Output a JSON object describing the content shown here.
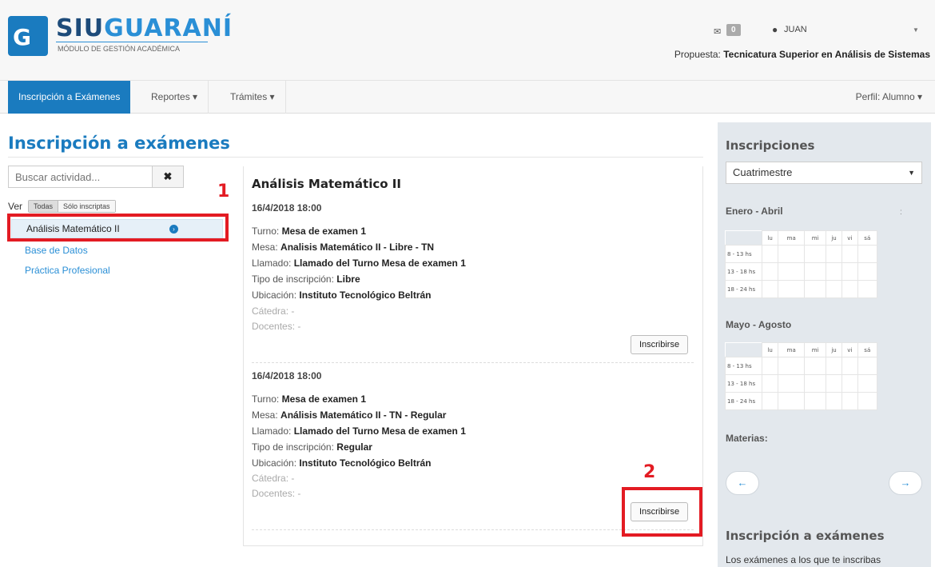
{
  "header": {
    "logo_letter": "G",
    "logo_siu": "SIU",
    "logo_guarani": "GUARANÍ",
    "logo_subtitle": "MÓDULO DE GESTIÓN ACADÉMICA",
    "mail_count": "0",
    "user_name": "JUAN",
    "propuesta_label": "Propuesta:",
    "propuesta_value": "Tecnicatura Superior en Análisis de Sistemas"
  },
  "navbar": {
    "items": [
      {
        "label": "Inscripción a Exámenes"
      },
      {
        "label": "Reportes ▾"
      },
      {
        "label": "Trámites ▾"
      }
    ],
    "perfil": "Perfil: Alumno ▾"
  },
  "page": {
    "title": "Inscripción a exámenes"
  },
  "sidebar": {
    "search_placeholder": "Buscar actividad...",
    "clear_icon": "✖",
    "ver_label": "Ver",
    "filters": [
      "Todas",
      "Sólo inscriptas"
    ],
    "activities": [
      "Análisis Matemático II",
      "Base de Datos",
      "Práctica Profesional"
    ],
    "chevron": "›"
  },
  "markers": {
    "one": "1",
    "two": "2"
  },
  "main": {
    "title": "Análisis Matemático II",
    "exams": [
      {
        "date": "16/4/2018 18:00",
        "turno_label": "Turno:",
        "turno": "Mesa de examen 1",
        "mesa_label": "Mesa:",
        "mesa": "Analisis Matemático II - Libre - TN",
        "llamado_label": "Llamado:",
        "llamado": "Llamado del Turno Mesa de examen 1",
        "tipo_label": "Tipo de inscripción:",
        "tipo": "Libre",
        "ubicacion_label": "Ubicación:",
        "ubicacion": "Instituto Tecnológico Beltrán",
        "catedra": "Cátedra: -",
        "docentes": "Docentes: -",
        "button": "Inscribirse"
      },
      {
        "date": "16/4/2018 18:00",
        "turno_label": "Turno:",
        "turno": "Mesa de examen 1",
        "mesa_label": "Mesa:",
        "mesa": "Análisis Matemático II - TN - Regular",
        "llamado_label": "Llamado:",
        "llamado": "Llamado del Turno Mesa de examen 1",
        "tipo_label": "Tipo de inscripción:",
        "tipo": "Regular",
        "ubicacion_label": "Ubicación:",
        "ubicacion": "Instituto Tecnológico Beltrán",
        "catedra": "Cátedra: -",
        "docentes": "Docentes: -",
        "button": "Inscribirse"
      }
    ]
  },
  "right_panel": {
    "title": "Inscripciones",
    "select_value": "Cuatrimestre",
    "period_1": "Enero - Abril",
    "period_2": "Mayo - Agosto",
    "dots": ":",
    "days": [
      "lu",
      "ma",
      "mi",
      "ju",
      "vi",
      "sá"
    ],
    "slots": [
      "8 - 13 hs",
      "13 - 18 hs",
      "18 - 24 hs"
    ],
    "materias_label": "Materias:",
    "prev_arrow": "←",
    "next_arrow": "→",
    "section_title": "Inscripción a exámenes",
    "description": "Los exámenes a los que te inscribas"
  }
}
